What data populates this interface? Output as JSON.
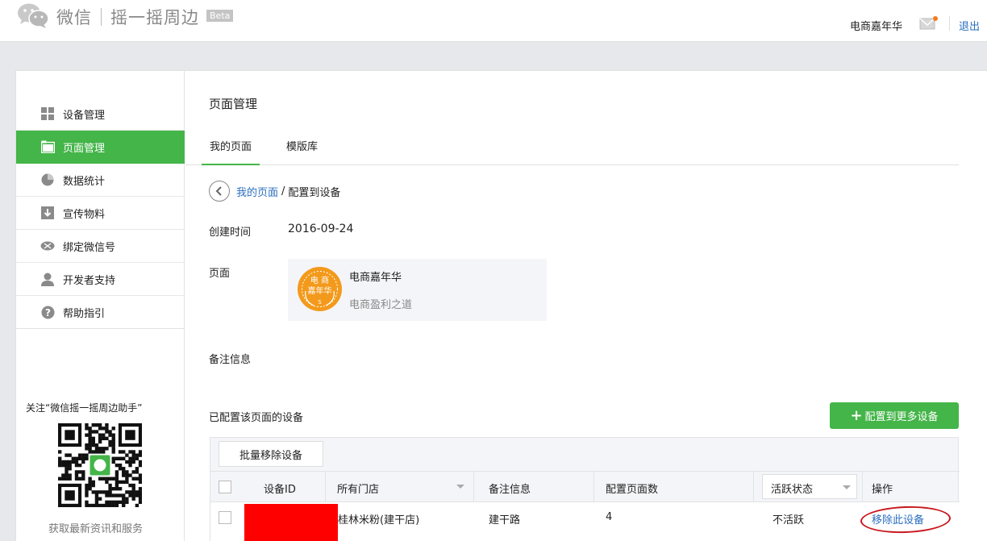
{
  "header": {
    "brand": "微信",
    "product": "摇一摇周边",
    "beta": "Beta",
    "account": "电商嘉年华",
    "logout": "退出",
    "icons": [
      "wechat-logo-icon",
      "mail-icon"
    ],
    "accent": "#44b549"
  },
  "sidebar": {
    "items": [
      {
        "label": "设备管理",
        "icon": "grid-icon",
        "active": false
      },
      {
        "label": "页面管理",
        "icon": "page-icon",
        "active": true
      },
      {
        "label": "数据统计",
        "icon": "pie-chart-icon",
        "active": false
      },
      {
        "label": "宣传物料",
        "icon": "download-icon",
        "active": false
      },
      {
        "label": "绑定微信号",
        "icon": "link-icon",
        "active": false
      },
      {
        "label": "开发者支持",
        "icon": "user-icon",
        "active": false
      },
      {
        "label": "帮助指引",
        "icon": "help-icon",
        "active": false
      }
    ],
    "qr_caption": "关注“微信摇一摇周边助手”",
    "qr_footer": "获取最新资讯和服务"
  },
  "main": {
    "title": "页面管理",
    "tabs": [
      {
        "label": "我的页面",
        "active": true
      },
      {
        "label": "模版库",
        "active": false
      }
    ],
    "breadcrumb": {
      "link": "我的页面",
      "separator": "/",
      "current": "配置到设备"
    },
    "created_label": "创建时间",
    "created_value": "2016-09-24",
    "page_label": "页面",
    "page_card": {
      "title": "电商嘉年华",
      "subtitle": "电商盈利之道",
      "logo_text_top": "电 商",
      "logo_text_mid": "嘉年华",
      "logo_text_bot": "S"
    },
    "remark_label": "备注信息",
    "devices_title": "已配置该页面的设备",
    "add_button": "配置到更多设备",
    "table": {
      "bulk_remove": "批量移除设备",
      "columns": [
        "设备ID",
        "所有门店",
        "备注信息",
        "配置页面数",
        "活跃状态",
        "操作"
      ],
      "rows": [
        {
          "device_id": "",
          "store": "桂林米粉(建干店)",
          "remark": "建干路",
          "page_count": "4",
          "status": "不活跃",
          "action": "移除此设备"
        }
      ]
    }
  }
}
